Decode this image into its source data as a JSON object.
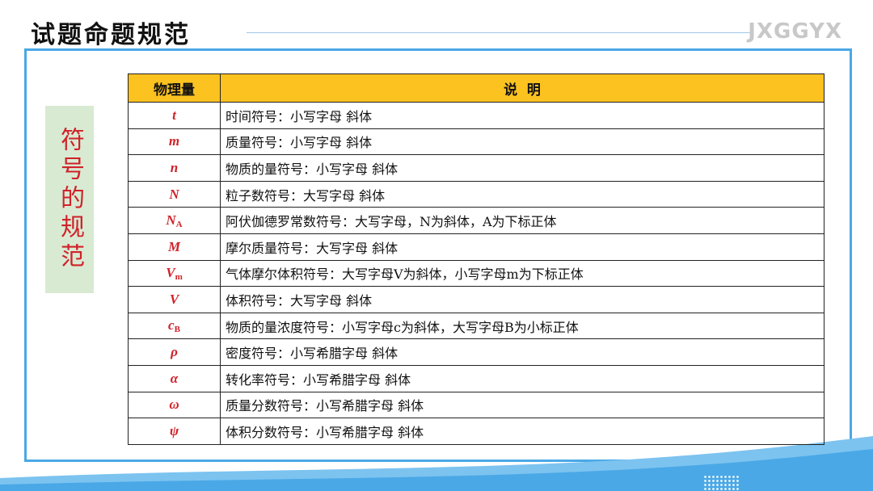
{
  "header": {
    "title": "试题命题规范",
    "brand": "JXGGYX"
  },
  "side_label": "符号的规范",
  "table": {
    "columns": [
      "物理量",
      "说  明"
    ],
    "rows": [
      {
        "symbol": "t",
        "subscript": "",
        "description": "时间符号：小写字母 斜体"
      },
      {
        "symbol": "m",
        "subscript": "",
        "description": "质量符号：小写字母 斜体"
      },
      {
        "symbol": "n",
        "subscript": "",
        "description": "物质的量符号：小写字母 斜体"
      },
      {
        "symbol": "N",
        "subscript": "",
        "description": "粒子数符号：大写字母 斜体"
      },
      {
        "symbol": "N",
        "subscript": "A",
        "description": "阿伏伽德罗常数符号：大写字母，N为斜体，A为下标正体"
      },
      {
        "symbol": "M",
        "subscript": "",
        "description": "摩尔质量符号：大写字母 斜体"
      },
      {
        "symbol": "V",
        "subscript": "m",
        "description": "气体摩尔体积符号：大写字母V为斜体，小写字母m为下标正体"
      },
      {
        "symbol": "V",
        "subscript": "",
        "description": "体积符号：大写字母 斜体"
      },
      {
        "symbol": "c",
        "subscript": "B",
        "description": "物质的量浓度符号：小写字母c为斜体，大写字母B为小标正体"
      },
      {
        "symbol": "ρ",
        "subscript": "",
        "description": "密度符号：小写希腊字母 斜体"
      },
      {
        "symbol": "α",
        "subscript": "",
        "description": "转化率符号：小写希腊字母 斜体"
      },
      {
        "symbol": "ω",
        "subscript": "",
        "description": "质量分数符号：小写希腊字母 斜体"
      },
      {
        "symbol": "ψ",
        "subscript": "",
        "description": "体积分数符号：小写希腊字母 斜体"
      }
    ]
  },
  "colors": {
    "header_fill": "#fcc220",
    "symbol_red": "#d0222a",
    "frame_blue": "#4aa8e6",
    "side_label_bg": "#d9ead3"
  }
}
